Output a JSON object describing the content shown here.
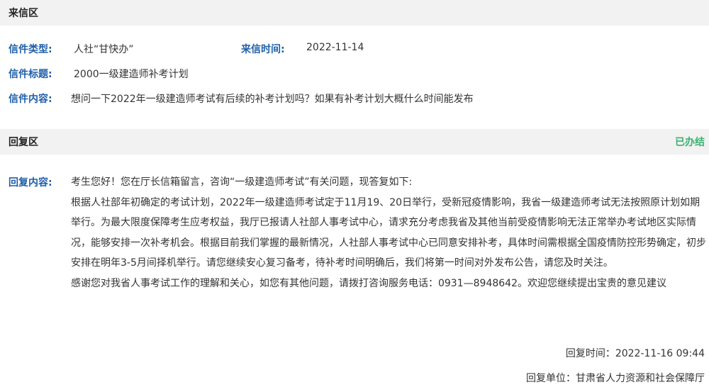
{
  "letter_section": {
    "title": "来信区",
    "type_label": "信件类型:",
    "type_value": "人社“甘快办”",
    "time_label": "来信时间:",
    "time_value": "2022-11-14",
    "subject_label": "信件标题:",
    "subject_value": "2000一级建造师补考计划",
    "content_label": "信件内容:",
    "content_value": "想问一下2022年一级建造师考试有后续的补考计划吗？如果有补考计划大概什么时间能发布"
  },
  "reply_section": {
    "title": "回复区",
    "status": "已办结",
    "content_label": "回复内容:",
    "paragraphs": [
      "考生您好！您在厅长信箱留言，咨询“一级建造师考试”有关问题，现答复如下:",
      "根据人社部年初确定的考试计划，2022年一级建造师考试定于11月19、20日举行，受新冠疫情影响，我省一级建造师考试无法按照原计划如期举行。为最大限度保障考生应考权益，我厅已报请人社部人事考试中心，请求充分考虑我省及其他当前受疫情影响无法正常举办考试地区实际情况，能够安排一次补考机会。根据目前我们掌握的最新情况，人社部人事考试中心已同意安排补考，具体时间需根据全国疫情防控形势确定，初步安排在明年3-5月间择机举行。请您继续安心复习备考，待补考时间明确后，我们将第一时间对外发布公告，请您及时关注。",
      "感谢您对我省人事考试工作的理解和关心，如您有其他问题，请拨打咨询服务电话：0931—8948642。欢迎您继续提出宝贵的意见建议"
    ],
    "reply_time": "回复时间：2022-11-16 09:44",
    "reply_unit": "回复单位：甘肃省人力资源和社会保障厅"
  }
}
